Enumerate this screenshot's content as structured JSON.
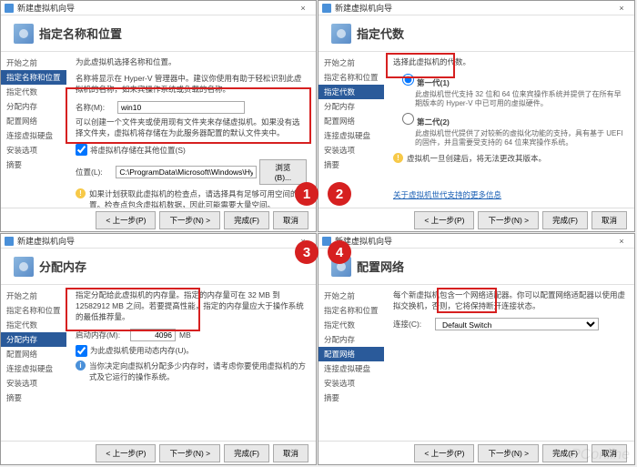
{
  "title": "新建虚拟机向导",
  "close": "×",
  "sidebar": {
    "items": [
      "开始之前",
      "指定名称和位置",
      "指定代数",
      "分配内存",
      "配置网络",
      "连接虚拟硬盘",
      "安装选项",
      "摘要"
    ]
  },
  "buttons": {
    "prev": "< 上一步(P)",
    "next": "下一步(N) >",
    "finish": "完成(F)",
    "cancel": "取消",
    "browse": "浏览(B)..."
  },
  "p1": {
    "header": "指定名称和位置",
    "desc": "为此虚拟机选择名称和位置。",
    "desc2": "名称将显示在 Hyper-V 管理器中。建议你使用有助于轻松识别此虚拟机的名称，如来宾操作系统或负载的名称。",
    "name_label": "名称(M):",
    "name_value": "win10",
    "store_desc": "可以创建一个文件夹或使用现有文件夹来存储虚拟机。如果没有选择文件夹，虚拟机将存储在为此服务器配置的默认文件夹中。",
    "chk_label": "将虚拟机存储在其他位置(S)",
    "loc_label": "位置(L):",
    "loc_value": "C:\\ProgramData\\Microsoft\\Windows\\Hyper-V\\",
    "warn": "如果计划获取此虚拟机的检查点，请选择具有足够可用空间的位置。检查点包含虚拟机数据，因此可能需要大量空间。"
  },
  "p2": {
    "header": "指定代数",
    "desc": "选择此虚拟机的代数。",
    "opt1": "第一代(1)",
    "opt1_desc": "此虚拟机世代支持 32 位和 64 位来宾操作系统并提供了在所有早期版本的 Hyper-V 中已可用的虚拟硬件。",
    "opt2": "第二代(2)",
    "opt2_desc": "此虚拟机世代提供了对较新的虚拟化功能的支持，具有基于 UEFI 的固件，并且需要受支持的 64 位来宾操作系统。",
    "warn": "虚拟机一旦创建后，将无法更改其版本。",
    "link": "关于虚拟机世代支持的更多信息"
  },
  "p3": {
    "header": "分配内存",
    "desc": "指定分配给此虚拟机的内存量。指定的内存量可在 32 MB 到 12582912 MB 之间。若要提高性能，指定的内存量应大于操作系统的最低推荐量。",
    "mem_label": "启动内存(M):",
    "mem_value": "4096",
    "mem_unit": "MB",
    "chk_label": "为此虚拟机使用动态内存(U)。",
    "info": "当你决定向虚拟机分配多少内存时，请考虑你要使用虚拟机的方式及它运行的操作系统。"
  },
  "p4": {
    "header": "配置网络",
    "desc": "每个新虚拟机包含一个网络适配器。你可以配置网络适配器以使用虚拟交换机，否则，它将保持断开连接状态。",
    "conn_label": "连接(C):",
    "conn_value": "Default Switch"
  },
  "watermark": "PConline"
}
